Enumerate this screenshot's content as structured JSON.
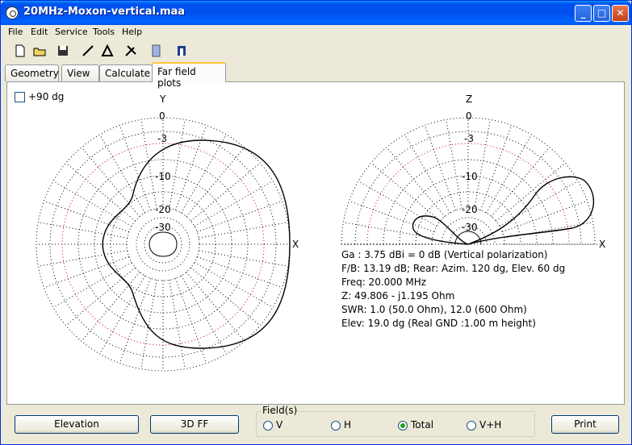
{
  "window": {
    "title": "20MHz-Moxon-vertical.maa"
  },
  "menu": [
    "File",
    "Edit",
    "Service",
    "Tools",
    "Help"
  ],
  "toolbar_icons": [
    "new-file-icon",
    "open-folder-icon",
    "save-icon",
    "line-icon",
    "triangle-icon",
    "tools-icon",
    "document-icon",
    "antenna-icon"
  ],
  "tabs": [
    "Geometry",
    "View",
    "Calculate",
    "Far field plots"
  ],
  "active_tab": "Far field plots",
  "checkbox_label": "+90 dg",
  "azimuth_plot": {
    "axis_top": "Y",
    "axis_right": "X",
    "ring_labels": [
      "0",
      "-3",
      "-10",
      "-20",
      "-30"
    ]
  },
  "elevation_plot": {
    "axis_top": "Z",
    "axis_right": "X",
    "ring_labels": [
      "0",
      "-3",
      "-10",
      "-20",
      "-30"
    ]
  },
  "info": {
    "ga": "Ga : 3.75 dBi = 0 dB  (Vertical polarization)",
    "fb": "F/B: 13.19 dB; Rear: Azim. 120 dg,  Elev. 60 dg",
    "freq": "Freq: 20.000 MHz",
    "z": "Z: 49.806 - j1.195 Ohm",
    "swr": "SWR: 1.0 (50.0 Ohm), 12.0 (600 Ohm)",
    "elev": "Elev: 19.0 dg (Real GND  :1.00 m height)"
  },
  "bottom": {
    "elevation_button": "Elevation",
    "ff3d_button": "3D FF",
    "fields_legend": "Field(s)",
    "radio_v": "V",
    "radio_h": "H",
    "radio_total": "Total",
    "radio_vh": "V+H",
    "selected_field": "Total",
    "print_button": "Print"
  },
  "colors": {
    "grid_dot": "#000000",
    "grid_red": "#cc0000",
    "pattern": "#000000"
  }
}
